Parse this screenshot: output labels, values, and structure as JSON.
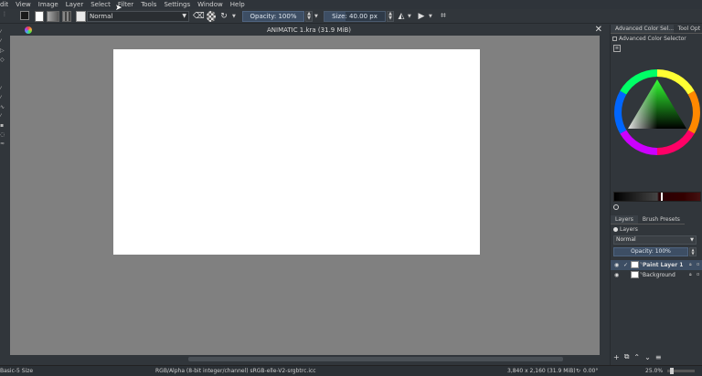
{
  "menu": [
    "dit",
    "View",
    "Image",
    "Layer",
    "Select",
    "Filter",
    "Tools",
    "Settings",
    "Window",
    "Help"
  ],
  "toolbar": {
    "blend_mode": "Normal",
    "opacity": "Opacity: 100%",
    "size": "Size: 40.00 px",
    "size_fill_fraction": 0.35
  },
  "document": {
    "title": "ANIMATIC 1.kra (31.9 MiB)"
  },
  "docker": {
    "tabs": [
      "Advanced Color Sel...",
      "Tool Opt"
    ],
    "acs_title": "Advanced Color Selector",
    "layer_tabs": [
      "Layers",
      "Brush Presets"
    ],
    "layers_title": "Layers",
    "blend_mode": "Normal",
    "opacity": "Opacity:  100%",
    "layers": [
      {
        "name": "Paint Layer 1",
        "active": true
      },
      {
        "name": "Background",
        "active": false
      }
    ]
  },
  "status": {
    "brush": "Basic-5 Size",
    "color_space": "RGB/Alpha (8-bit integer/channel)  sRGB-elle-V2-srgbtrc.icc",
    "dimensions": "3,840 x 2,160 (31.9 MiB)",
    "rotation": "0.00°",
    "zoom": "25.0%"
  }
}
